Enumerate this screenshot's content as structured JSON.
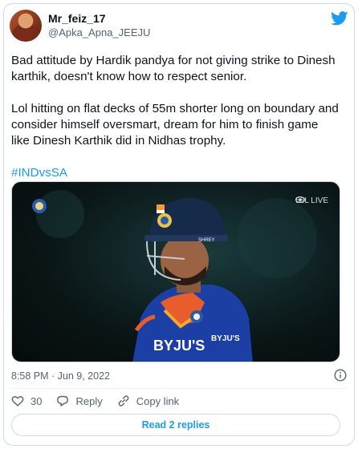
{
  "user": {
    "display_name": "Mr_feiz_17",
    "handle": "@Apka_Apna_JEEJU",
    "avatar_icon": "profile-avatar"
  },
  "brand_icon": "twitter-bird-icon",
  "tweet": {
    "paragraph_1": "Bad attitude by Hardik pandya for not giving strike to Dinesh karthik, doesn't know how to respect senior.",
    "paragraph_2": "Lol hitting on flat decks of 55m shorter long on boundary and consider himself oversmart, dream for him to finish game like Dinesh Karthik did in Nidhas trophy.",
    "hashtag": "#INDvsSA"
  },
  "media": {
    "live_label": "58L LIVE",
    "jersey_text": "BYJU'S",
    "jersey_chest_text": "BYJU'S",
    "helmet_band_text": "SHREY"
  },
  "meta": {
    "timestamp": "8:58 PM · Jun 9, 2022"
  },
  "actions": {
    "likes_count": "30",
    "reply_label": "Reply",
    "copy_link_label": "Copy link"
  },
  "read_replies_label": "Read 2 replies",
  "colors": {
    "accent": "#1d9bf0",
    "text": "#0f1419",
    "muted": "#536471",
    "border": "#cfd9de"
  }
}
